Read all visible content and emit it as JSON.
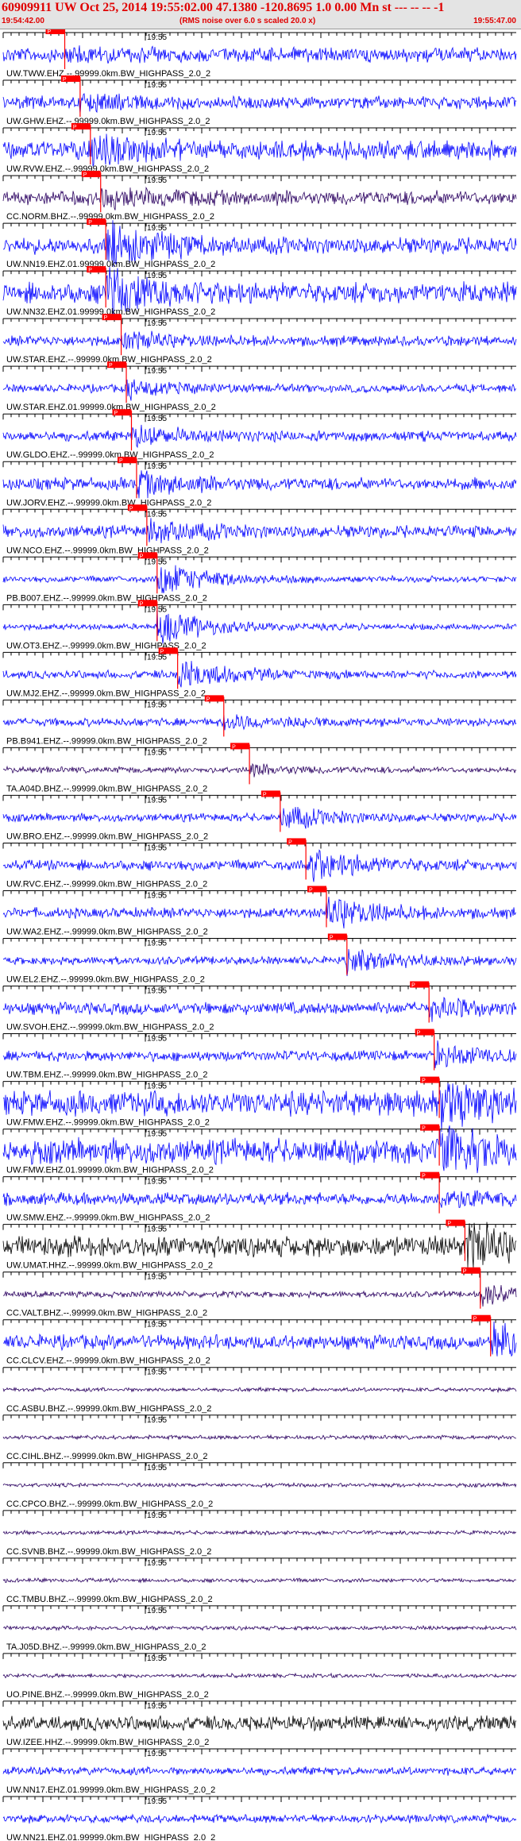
{
  "header": {
    "title": "60909911 UW Oct 25, 2014 19:55:02.00   47.1380 -120.8695  1.0 0.00 Mn st --- -- --  -1",
    "start_time": "19:54:42.00",
    "end_time": "19:55:47.00",
    "rms_note": "(RMS noise over 6.0 s scaled 20.0 x)"
  },
  "colors": {
    "trace": "#0000ff",
    "trace_dark": "#000000",
    "trace_purple": "#2a0060",
    "pick": "#ff0000",
    "header_bg": "#e4e4e4",
    "title": "#e00000"
  },
  "axis": {
    "time_label": "19:55",
    "time_window_s": 65
  },
  "traces": [
    {
      "label": "UW.TWW.EHZ.--.99999.0km.BW_HIGHPASS_2.0_2",
      "pick": "P",
      "amp": 0.35,
      "color": "blue",
      "burst": [
        0.12,
        0.2
      ]
    },
    {
      "label": "UW.GHW.EHZ.--.99999.0km.BW_HIGHPASS_2.0_2",
      "pick": "P",
      "amp": 0.3,
      "color": "blue",
      "burst": [
        0.15,
        0.25
      ]
    },
    {
      "label": "UW.RVW.EHZ.--.99999.0km.BW_HIGHPASS_2.0_2",
      "pick": "P",
      "amp": 0.45,
      "color": "blue",
      "burst": [
        0.17,
        0.5
      ]
    },
    {
      "label": "CC.NORM.BHZ.--.99999.0km.BW_HIGHPASS_2.0_2",
      "pick": "P",
      "amp": 0.35,
      "color": "purple",
      "burst": [
        0.19,
        0.3
      ]
    },
    {
      "label": "UW.NN19.EHZ.01.99999.0km.BW_HIGHPASS_2.0_2",
      "pick": "P",
      "amp": 0.4,
      "color": "blue",
      "burst": [
        0.2,
        0.9
      ]
    },
    {
      "label": "UW.NN32.EHZ.01.99999.0km.BW_HIGHPASS_2.0_2",
      "pick": "P",
      "amp": 0.5,
      "color": "blue",
      "burst": [
        0.2,
        0.9
      ]
    },
    {
      "label": "UW.STAR.EHZ.--.99999.0km.BW_HIGHPASS_2.0_2",
      "pick": "P",
      "amp": 0.25,
      "color": "blue",
      "burst": [
        0.23,
        0.35
      ]
    },
    {
      "label": "UW.STAR.EHZ.01.99999.0km.BW_HIGHPASS_2.0_2",
      "pick": "P",
      "amp": 0.2,
      "color": "blue",
      "burst": [
        0.24,
        0.35
      ]
    },
    {
      "label": "UW.GLDO.EHZ.--.99999.0km.BW_HIGHPASS_2.0_2",
      "pick": "P",
      "amp": 0.25,
      "color": "blue",
      "burst": [
        0.25,
        0.4
      ]
    },
    {
      "label": "UW.JORV.EHZ.--.99999.0km.BW_HIGHPASS_2.0_2",
      "pick": "P",
      "amp": 0.3,
      "color": "blue",
      "burst": [
        0.26,
        0.45
      ]
    },
    {
      "label": "UW.NCO.EHZ.--.99999.0km.BW_HIGHPASS_2.0_2",
      "pick": "P",
      "amp": 0.3,
      "color": "blue",
      "burst": [
        0.28,
        0.5
      ]
    },
    {
      "label": "PB.B007.EHZ.--.99999.0km.BW_HIGHPASS_2.0_2",
      "pick": "P",
      "amp": 0.15,
      "color": "blue",
      "burst": [
        0.3,
        0.8
      ]
    },
    {
      "label": "UW.OT3.EHZ.--.99999.0km.BW_HIGHPASS_2.0_2",
      "pick": "P",
      "amp": 0.15,
      "color": "blue",
      "burst": [
        0.3,
        0.8
      ]
    },
    {
      "label": "UW.MJ2.EHZ.--.99999.0km.BW_HIGHPASS_2.0_2",
      "pick": "P",
      "amp": 0.2,
      "color": "blue",
      "burst": [
        0.34,
        0.6
      ]
    },
    {
      "label": "PB.B941.EHZ.--.99999.0km.BW_HIGHPASS_2.0_2",
      "pick": "P",
      "amp": 0.2,
      "color": "blue",
      "burst": [
        0.43,
        0.3
      ]
    },
    {
      "label": "TA.A04D.BHZ.--.99999.0km.BW_HIGHPASS_2.0_2",
      "pick": "P",
      "amp": 0.15,
      "color": "purple",
      "burst": [
        0.48,
        0.2
      ]
    },
    {
      "label": "UW.BRO.EHZ.--.99999.0km.BW_HIGHPASS_2.0_2",
      "pick": "P",
      "amp": 0.2,
      "color": "blue",
      "burst": [
        0.54,
        0.5
      ]
    },
    {
      "label": "UW.RVC.EHZ.--.99999.0km.BW_HIGHPASS_2.0_2",
      "pick": "P",
      "amp": 0.25,
      "color": "blue",
      "burst": [
        0.59,
        0.8
      ]
    },
    {
      "label": "UW.WA2.EHZ.--.99999.0km.BW_HIGHPASS_2.0_2",
      "pick": "P",
      "amp": 0.25,
      "color": "blue",
      "burst": [
        0.63,
        0.7
      ]
    },
    {
      "label": "UW.EL2.EHZ.--.99999.0km.BW_HIGHPASS_2.0_2",
      "pick": "P",
      "amp": 0.2,
      "color": "blue",
      "burst": [
        0.67,
        0.5
      ]
    },
    {
      "label": "UW.SVOH.EHZ.--.99999.0km.BW_HIGHPASS_2.0_2",
      "pick": "P",
      "amp": 0.3,
      "color": "blue",
      "burst": [
        0.83,
        0.4
      ]
    },
    {
      "label": "UW.TBM.EHZ.--.99999.0km.BW_HIGHPASS_2.0_2",
      "pick": "P",
      "amp": 0.25,
      "color": "blue",
      "burst": [
        0.84,
        0.5
      ]
    },
    {
      "label": "UW.FMW.EHZ.--.99999.0km.BW_HIGHPASS_2.0_2",
      "pick": "P",
      "amp": 0.6,
      "color": "blue",
      "burst": [
        0.85,
        0.9
      ]
    },
    {
      "label": "UW.FMW.EHZ.01.99999.0km.BW_HIGHPASS_2.0_2",
      "pick": "P",
      "amp": 0.6,
      "color": "blue",
      "burst": [
        0.85,
        0.9
      ]
    },
    {
      "label": "UW.SMW.EHZ.--.99999.0km.BW_HIGHPASS_2.0_2",
      "pick": "P",
      "amp": 0.3,
      "color": "blue",
      "burst": [
        0.85,
        0.4
      ]
    },
    {
      "label": "UW.UMAT.HHZ.--.99999.0km.BW_HIGHPASS_2.0_2",
      "pick": "P",
      "amp": 0.5,
      "color": "black",
      "burst": [
        0.9,
        0.9
      ]
    },
    {
      "label": "CC.VALT.BHZ.--.99999.0km.BW_HIGHPASS_2.0_2",
      "pick": "P",
      "amp": 0.15,
      "color": "purple",
      "burst": [
        0.93,
        0.5
      ]
    },
    {
      "label": "CC.CLCV.EHZ.--.99999.0km.BW_HIGHPASS_2.0_2",
      "pick": "P",
      "amp": 0.35,
      "color": "blue",
      "burst": [
        0.95,
        0.8
      ]
    },
    {
      "label": "CC.ASBU.BHZ.--.99999.0km.BW_HIGHPASS_2.0_2",
      "pick": "",
      "amp": 0.1,
      "color": "purple",
      "burst": null
    },
    {
      "label": "CC.CIHL.BHZ.--.99999.0km.BW_HIGHPASS_2.0_2",
      "pick": "",
      "amp": 0.1,
      "color": "purple",
      "burst": null
    },
    {
      "label": "CC.CPCO.BHZ.--.99999.0km.BW_HIGHPASS_2.0_2",
      "pick": "",
      "amp": 0.1,
      "color": "purple",
      "burst": null
    },
    {
      "label": "CC.SVNB.BHZ.--.99999.0km.BW_HIGHPASS_2.0_2",
      "pick": "",
      "amp": 0.1,
      "color": "purple",
      "burst": null
    },
    {
      "label": "CC.TMBU.BHZ.--.99999.0km.BW_HIGHPASS_2.0_2",
      "pick": "",
      "amp": 0.1,
      "color": "purple",
      "burst": null
    },
    {
      "label": "TA.J05D.BHZ.--.99999.0km.BW_HIGHPASS_2.0_2",
      "pick": "",
      "amp": 0.1,
      "color": "purple",
      "burst": null
    },
    {
      "label": "UO.PINE.BHZ.--.99999.0km.BW_HIGHPASS_2.0_2",
      "pick": "",
      "amp": 0.1,
      "color": "purple",
      "burst": null
    },
    {
      "label": "UW.IZEE.HHZ.--.99999.0km.BW_HIGHPASS_2.0_2",
      "pick": "",
      "amp": 0.35,
      "color": "black",
      "burst": null
    },
    {
      "label": "UW.NN17.EHZ.01.99999.0km.BW_HIGHPASS_2.0_2",
      "pick": "",
      "amp": 0.2,
      "color": "blue",
      "burst": null
    },
    {
      "label": "UW.NN21.EHZ.01.99999.0km.BW_HIGHPASS_2.0_2",
      "pick": "",
      "amp": 0.2,
      "color": "blue",
      "burst": null
    }
  ]
}
